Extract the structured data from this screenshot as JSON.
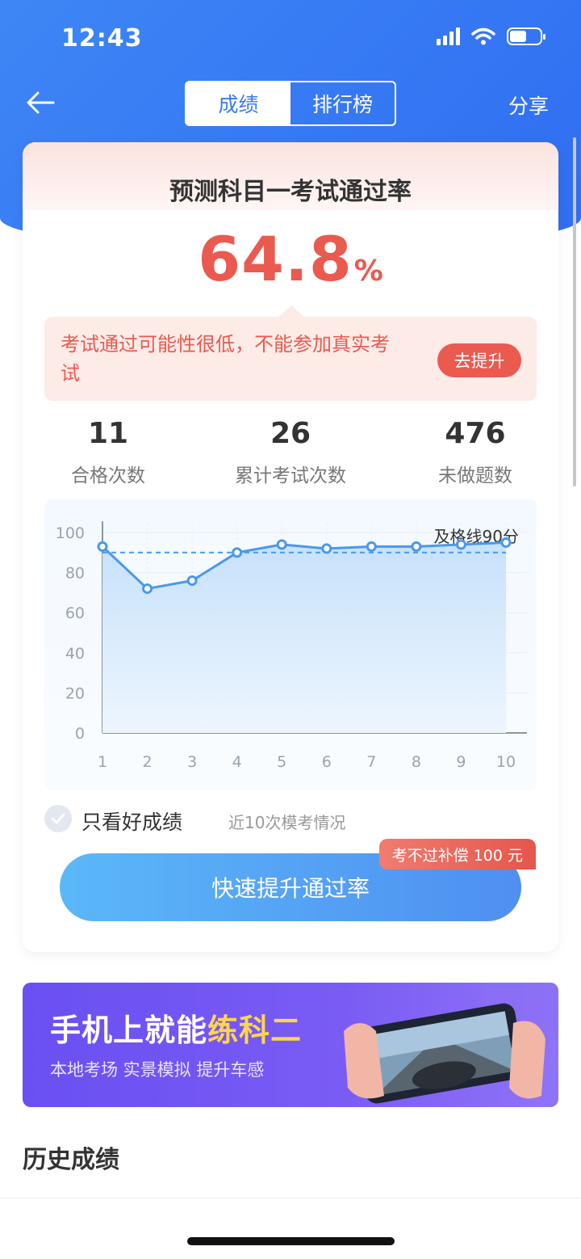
{
  "status_bar": {
    "time": "12:43"
  },
  "nav": {
    "tabs": [
      {
        "label": "成绩",
        "active": true
      },
      {
        "label": "排行榜",
        "active": false
      }
    ],
    "share_label": "分享"
  },
  "card": {
    "title": "预测科目一考试通过率",
    "rate_value": "64.8",
    "rate_unit": "%",
    "warning_text": "考试通过可能性很低，不能参加真实考试",
    "warning_button": "去提升",
    "stats": [
      {
        "value": "11",
        "label": "合格次数"
      },
      {
        "value": "26",
        "label": "累计考试次数"
      },
      {
        "value": "476",
        "label": "未做题数"
      }
    ],
    "good_only_label": "只看好成绩",
    "recent_label": "近10次模考情况",
    "compensation_badge": "考不过补偿 100 元",
    "main_button": "快速提升通过率"
  },
  "chart_data": {
    "type": "area",
    "x": [
      1,
      2,
      3,
      4,
      5,
      6,
      7,
      8,
      9,
      10
    ],
    "series": [
      {
        "values": [
          93,
          72,
          76,
          90,
          94,
          92,
          93,
          93,
          94,
          95
        ]
      }
    ],
    "yticks": [
      0,
      20,
      40,
      60,
      80,
      100
    ],
    "ylim": [
      0,
      100
    ],
    "reference_line": {
      "value": 90,
      "label": "及格线90分"
    },
    "grid": true,
    "colors": {
      "line": "#4a98ec",
      "fill_top": "#c6e1fb",
      "fill_bottom": "#eef6fe",
      "ref": "#4a98ec"
    }
  },
  "banner": {
    "title_part1": "手机上就能",
    "title_highlight": "练科二",
    "subtitle": "本地考场 实景模拟 提升车感"
  },
  "history_title": "历史成绩",
  "colors": {
    "primary": "#3b7bf0",
    "danger": "#ea5a4f",
    "banner": "#6a4ff2"
  }
}
